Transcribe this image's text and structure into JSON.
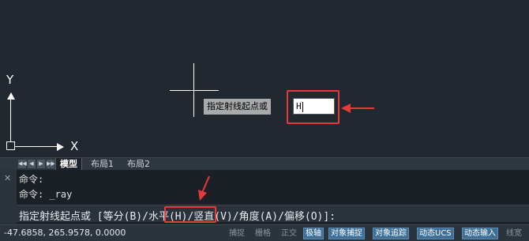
{
  "canvas": {
    "ucs": {
      "y_label": "Y",
      "x_label": "X"
    },
    "dynamic_input": {
      "prompt": "指定射线起点或",
      "value": "H"
    }
  },
  "tabs": {
    "nav_buttons": [
      "◀◀",
      "◀",
      "▶",
      "▶▶"
    ],
    "items": [
      {
        "label": "模型",
        "active": true
      },
      {
        "label": "布局1",
        "active": false
      },
      {
        "label": "布局2",
        "active": false
      }
    ]
  },
  "command": {
    "close_glyph": "✕",
    "history": [
      "命令:",
      "命令: _ray"
    ],
    "prompt_before": "指定射线起点或 [等分(B)",
    "prompt_highlight": "/水平(H)",
    "prompt_after": "/竖直(V)/角度(A)/偏移(O)]:"
  },
  "status": {
    "coordinates": "-47.6858, 265.9578, 0.0000",
    "toggles": [
      {
        "label": "捕捉",
        "on": false
      },
      {
        "label": "栅格",
        "on": false
      },
      {
        "label": "正交",
        "on": false
      },
      {
        "label": "极轴",
        "on": true
      },
      {
        "label": "对象捕捉",
        "on": true
      },
      {
        "label": "对象追踪",
        "on": true
      },
      {
        "label": "动态UCS",
        "on": true
      },
      {
        "label": "动态输入",
        "on": true
      },
      {
        "label": "线宽",
        "on": false
      }
    ]
  },
  "colors": {
    "canvas_bg": "#212830",
    "highlight_red": "#e53a3a",
    "toggle_on": "#3d6f99"
  }
}
